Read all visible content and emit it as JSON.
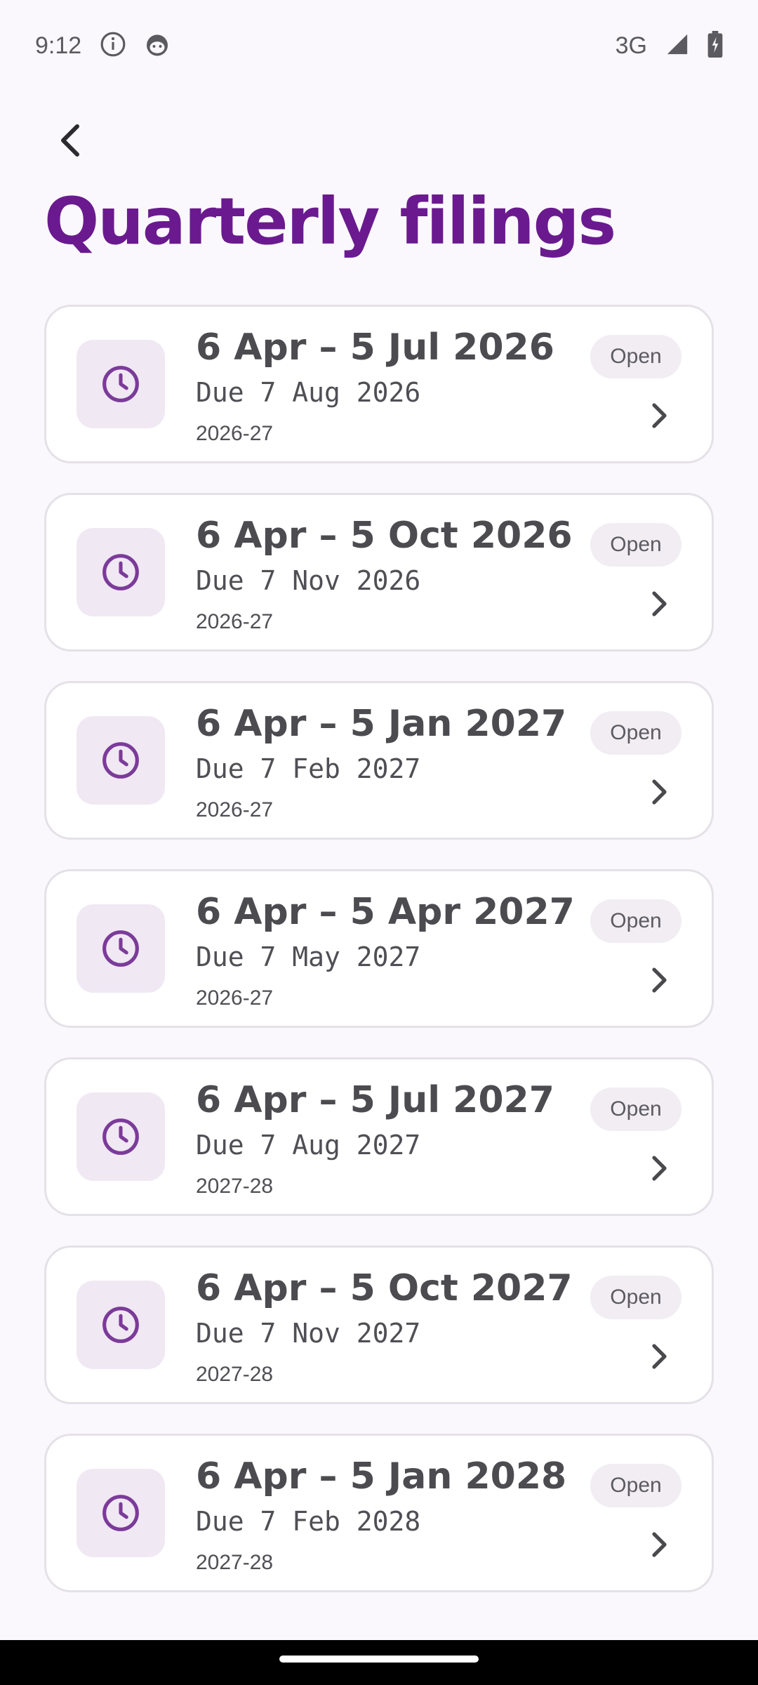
{
  "status_bar": {
    "time": "9:12",
    "network": "3G",
    "icons": [
      "info-icon",
      "face-icon",
      "signal-icon",
      "battery-charging-icon"
    ]
  },
  "header": {
    "back_icon": "back-arrow-icon",
    "title": "Quarterly filings"
  },
  "colors": {
    "title": "#6a1a8e",
    "icon_bg": "#f0e8f3",
    "icon_fg": "#7b3b99",
    "card_border": "#e4e1e8",
    "pill_bg": "#f1edf3"
  },
  "filings": [
    {
      "period": "6 Apr – 5 Jul 2026",
      "due": "Due 7 Aug 2026",
      "tax_year": "2026-27",
      "status": "Open",
      "icon": "clock-icon"
    },
    {
      "period": "6 Apr – 5 Oct 2026",
      "due": "Due 7 Nov 2026",
      "tax_year": "2026-27",
      "status": "Open",
      "icon": "clock-icon"
    },
    {
      "period": "6 Apr – 5 Jan 2027",
      "due": "Due 7 Feb 2027",
      "tax_year": "2026-27",
      "status": "Open",
      "icon": "clock-icon"
    },
    {
      "period": "6 Apr – 5 Apr 2027",
      "due": "Due 7 May 2027",
      "tax_year": "2026-27",
      "status": "Open",
      "icon": "clock-icon"
    },
    {
      "period": "6 Apr – 5 Jul 2027",
      "due": "Due 7 Aug 2027",
      "tax_year": "2027-28",
      "status": "Open",
      "icon": "clock-icon"
    },
    {
      "period": "6 Apr – 5 Oct 2027",
      "due": "Due 7 Nov 2027",
      "tax_year": "2027-28",
      "status": "Open",
      "icon": "clock-icon"
    },
    {
      "period": "6 Apr – 5 Jan 2028",
      "due": "Due 7 Feb 2028",
      "tax_year": "2027-28",
      "status": "Open",
      "icon": "clock-icon"
    }
  ]
}
